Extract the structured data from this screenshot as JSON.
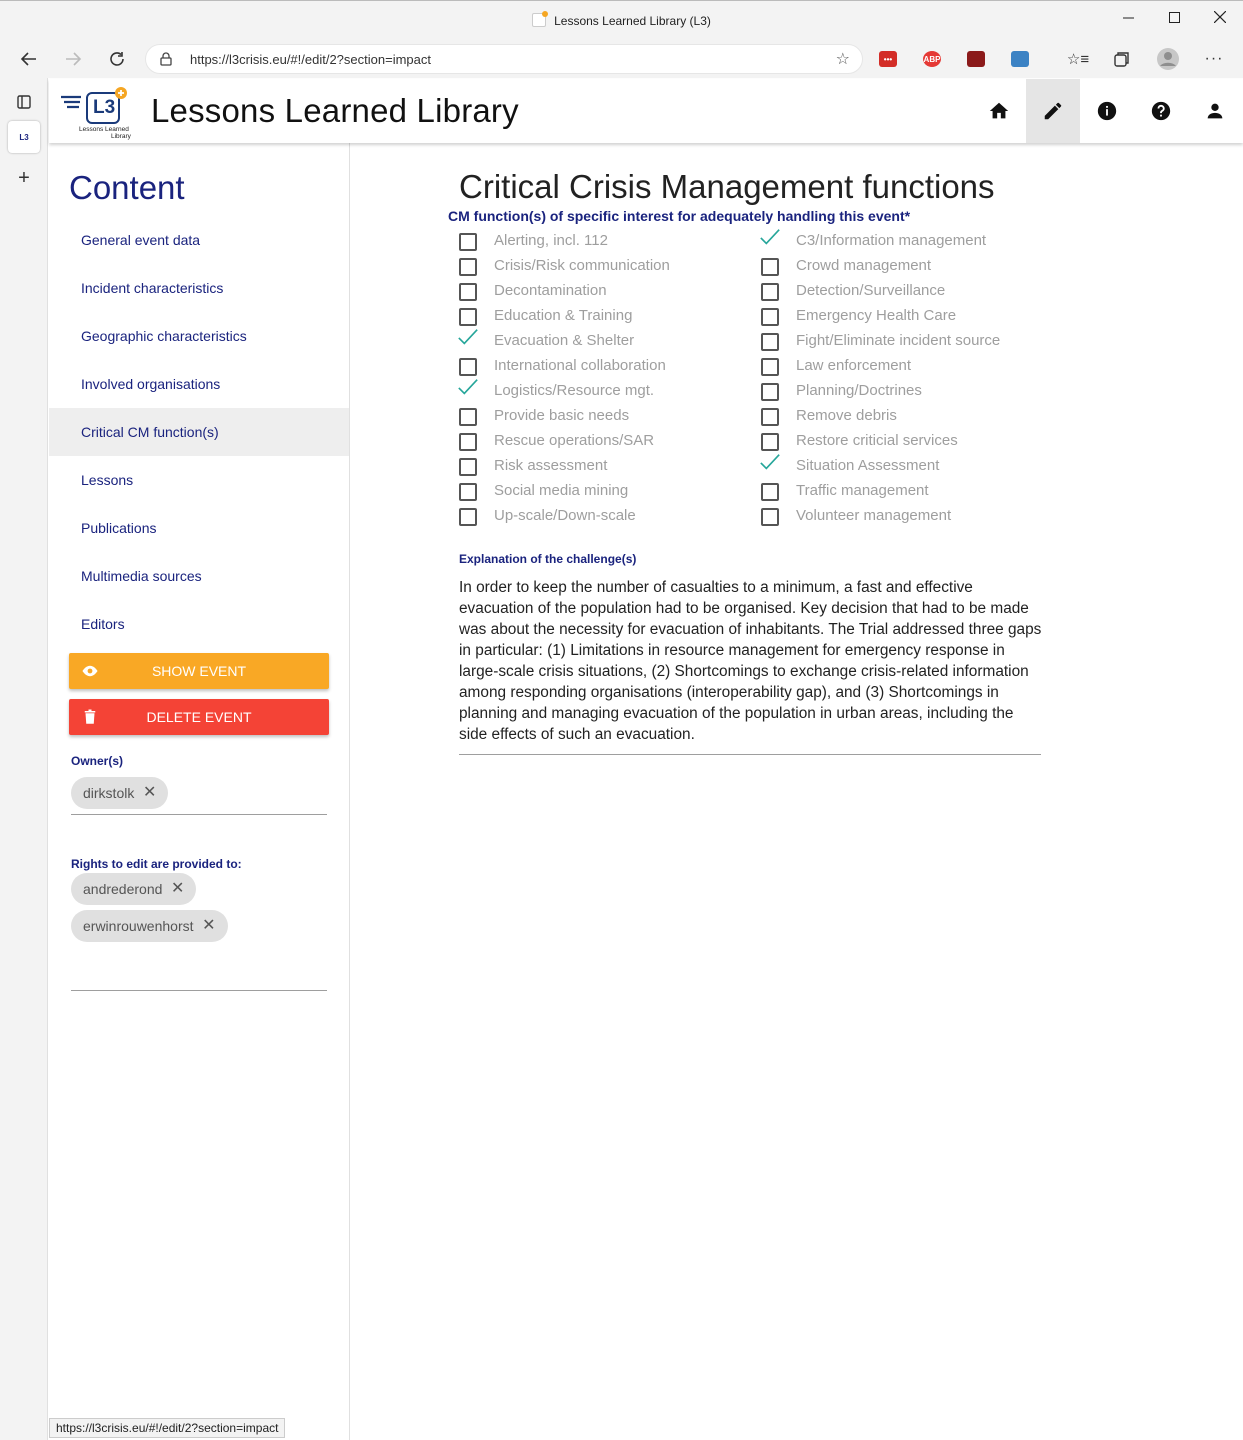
{
  "window": {
    "title": "Lessons Learned Library (L3)",
    "minimize_icon": "minimize-icon",
    "maximize_icon": "maximize-icon",
    "close_icon": "close-icon"
  },
  "browser": {
    "url": "https://l3crisis.eu/#!/edit/2?section=impact",
    "extensions": [
      {
        "name": "lastpass",
        "label": "•••",
        "color": "#d32d27"
      },
      {
        "name": "adblock-plus",
        "label": "ABP",
        "color": "#e53935"
      },
      {
        "name": "extension-3",
        "label": "",
        "color": "#8b1a1a"
      },
      {
        "name": "reader",
        "label": "",
        "color": "#3b82c4"
      }
    ]
  },
  "app": {
    "title": "Lessons Learned Library",
    "logo_text": "L3",
    "logo_caption_1": "Lessons Learned",
    "logo_caption_2": "Library"
  },
  "sidebar": {
    "title": "Content",
    "items": [
      {
        "label": "General event data",
        "active": false
      },
      {
        "label": "Incident characteristics",
        "active": false
      },
      {
        "label": "Geographic characteristics",
        "active": false
      },
      {
        "label": "Involved organisations",
        "active": false
      },
      {
        "label": "Critical CM function(s)",
        "active": true
      },
      {
        "label": "Lessons",
        "active": false
      },
      {
        "label": "Publications",
        "active": false
      },
      {
        "label": "Multimedia sources",
        "active": false
      },
      {
        "label": "Editors",
        "active": false
      }
    ],
    "show_event_label": "SHOW EVENT",
    "delete_event_label": "DELETE EVENT",
    "owners_label": "Owner(s)",
    "owners": [
      "dirkstolk"
    ],
    "rights_label": "Rights to edit are provided to:",
    "editors": [
      "andrederond",
      "erwinrouwenhorst"
    ]
  },
  "main": {
    "title": "Critical Crisis Management functions",
    "subtitle": "CM function(s) of specific interest for adequately handling this event*",
    "left_functions": [
      {
        "label": "Alerting, incl. 112",
        "checked": false
      },
      {
        "label": "Crisis/Risk communication",
        "checked": false
      },
      {
        "label": "Decontamination",
        "checked": false
      },
      {
        "label": "Education & Training",
        "checked": false
      },
      {
        "label": "Evacuation & Shelter",
        "checked": true
      },
      {
        "label": "International collaboration",
        "checked": false
      },
      {
        "label": "Logistics/Resource mgt.",
        "checked": true
      },
      {
        "label": "Provide basic needs",
        "checked": false
      },
      {
        "label": "Rescue operations/SAR",
        "checked": false
      },
      {
        "label": "Risk assessment",
        "checked": false
      },
      {
        "label": "Social media mining",
        "checked": false
      },
      {
        "label": "Up-scale/Down-scale",
        "checked": false
      }
    ],
    "right_functions": [
      {
        "label": "C3/Information management",
        "checked": true
      },
      {
        "label": "Crowd management",
        "checked": false
      },
      {
        "label": "Detection/Surveillance",
        "checked": false
      },
      {
        "label": "Emergency Health Care",
        "checked": false
      },
      {
        "label": "Fight/Eliminate incident source",
        "checked": false
      },
      {
        "label": "Law enforcement",
        "checked": false
      },
      {
        "label": "Planning/Doctrines",
        "checked": false
      },
      {
        "label": "Remove debris",
        "checked": false
      },
      {
        "label": "Restore criticial services",
        "checked": false
      },
      {
        "label": "Situation Assessment",
        "checked": true
      },
      {
        "label": "Traffic management",
        "checked": false
      },
      {
        "label": "Volunteer management",
        "checked": false
      }
    ],
    "explanation_label": "Explanation of the challenge(s)",
    "explanation_text": "In order to keep the number of casualties to a minimum, a fast and effective evacuation of the population had to be organised. Key decision that had to be made was about the necessity for evacuation of inhabitants. The Trial addressed three gaps in particular: (1) Limitations in resource management for emergency response in large-scale crisis situations, (2) Shortcomings to exchange crisis-related information among responding organisations (interoperability gap), and (3) Shortcomings in planning and managing evacuation of the population in urban areas, including the side effects of such an evacuation."
  },
  "statusbar": {
    "url": "https://l3crisis.eu/#!/edit/2?section=impact"
  },
  "colors": {
    "accent": "#1a237e",
    "check": "#26a69a",
    "show_button": "#f9a825",
    "delete_button": "#f44336"
  }
}
